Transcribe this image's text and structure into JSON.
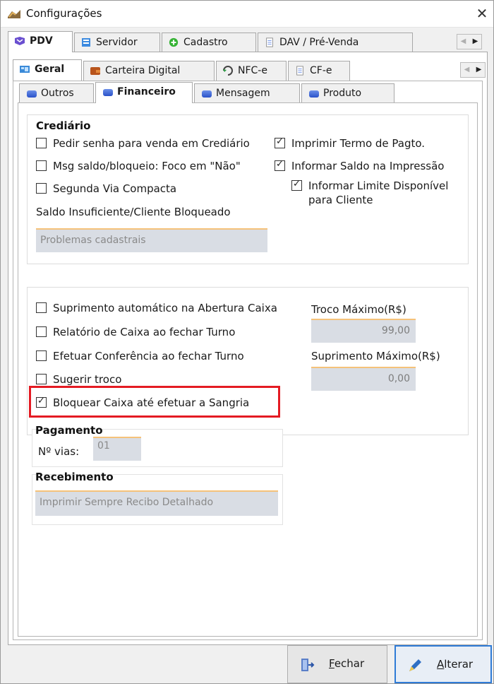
{
  "window": {
    "title": "Configurações",
    "close_glyph": "✕"
  },
  "tabs_level1": [
    {
      "label": "PDV",
      "icon": "pdv-icon"
    },
    {
      "label": "Servidor",
      "icon": "server-icon"
    },
    {
      "label": "Cadastro",
      "icon": "plus-circle-icon"
    },
    {
      "label": "DAV / Pré-Venda",
      "icon": "document-icon"
    }
  ],
  "tabs_level2": [
    {
      "label": "Geral",
      "icon": "geral-icon"
    },
    {
      "label": "Carteira Digital",
      "icon": "wallet-icon"
    },
    {
      "label": "NFC-e",
      "icon": "nfce-icon"
    },
    {
      "label": "CF-e",
      "icon": "document-icon"
    }
  ],
  "tabs_level3": [
    {
      "label": "Outros"
    },
    {
      "label": "Financeiro"
    },
    {
      "label": "Mensagem"
    },
    {
      "label": "Produto"
    }
  ],
  "crediario": {
    "title": "Crediário",
    "options": [
      {
        "label": "Pedir senha para venda em Crediário",
        "checked": false
      },
      {
        "label": "Msg saldo/bloqueio: Foco em \"Não\"",
        "checked": false
      },
      {
        "label": "Segunda Via Compacta",
        "checked": false
      },
      {
        "label": "Imprimir Termo de Pagto.",
        "checked": true
      },
      {
        "label": "Informar Saldo na Impressão",
        "checked": true
      },
      {
        "label": "Informar Limite Disponível",
        "label2": "para Cliente",
        "checked": true
      }
    ],
    "saldo_label": "Saldo Insuficiente/Cliente Bloqueado",
    "saldo_value": "Problemas cadastrais"
  },
  "caixa": {
    "options": [
      {
        "label": "Suprimento automático na Abertura Caixa",
        "checked": false
      },
      {
        "label": "Relatório de Caixa ao fechar Turno",
        "checked": false
      },
      {
        "label": "Efetuar Conferência ao fechar Turno",
        "checked": false
      },
      {
        "label": "Sugerir troco",
        "checked": false
      },
      {
        "label": "Bloquear Caixa até efetuar a Sangria",
        "checked": true
      }
    ],
    "troco_label": "Troco Máximo(R$)",
    "troco_value": "99,00",
    "suprimento_label": "Suprimento Máximo(R$)",
    "suprimento_value": "0,00"
  },
  "pagamento": {
    "title": "Pagamento",
    "vias_label": "Nº vias:",
    "vias_value": "01"
  },
  "recebimento": {
    "title": "Recebimento",
    "value": "Imprimir Sempre Recibo Detalhado"
  },
  "buttons": {
    "fechar": {
      "accel": "F",
      "rest": "echar"
    },
    "alterar": {
      "accel": "A",
      "rest": "lterar"
    }
  },
  "colors": {
    "highlight": "#e41b23",
    "field_accent": "#f5c27a",
    "primary_border": "#2f7bd6"
  }
}
